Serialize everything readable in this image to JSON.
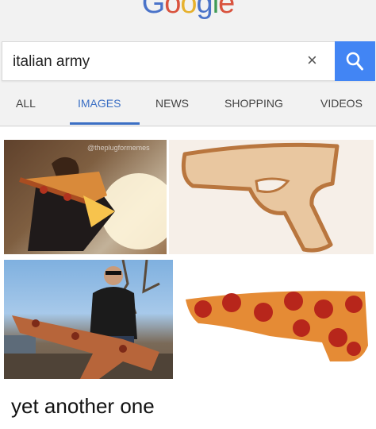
{
  "logo": {
    "g1": "G",
    "o1": "o",
    "o2": "o",
    "g2": "g",
    "l1": "l",
    "e1": "e"
  },
  "search": {
    "query": "italian army",
    "clear": "×"
  },
  "tabs": [
    {
      "label": "ALL"
    },
    {
      "label": "IMAGES",
      "active": true
    },
    {
      "label": "NEWS"
    },
    {
      "label": "SHOPPING"
    },
    {
      "label": "VIDEOS"
    }
  ],
  "results": {
    "watermark": "@theplugformemes",
    "images": [
      {
        "icon": "man-firing-pizza-gun-image"
      },
      {
        "icon": "pizza-crust-pistol-image"
      },
      {
        "icon": "man-with-pizza-rifle-image"
      },
      {
        "icon": "pepperoni-pistol-image"
      }
    ]
  },
  "caption": "yet another one",
  "colors": {
    "accent": "#4285f4",
    "tab_active": "#3b6fc4",
    "header_bg": "#f2f2f2"
  }
}
